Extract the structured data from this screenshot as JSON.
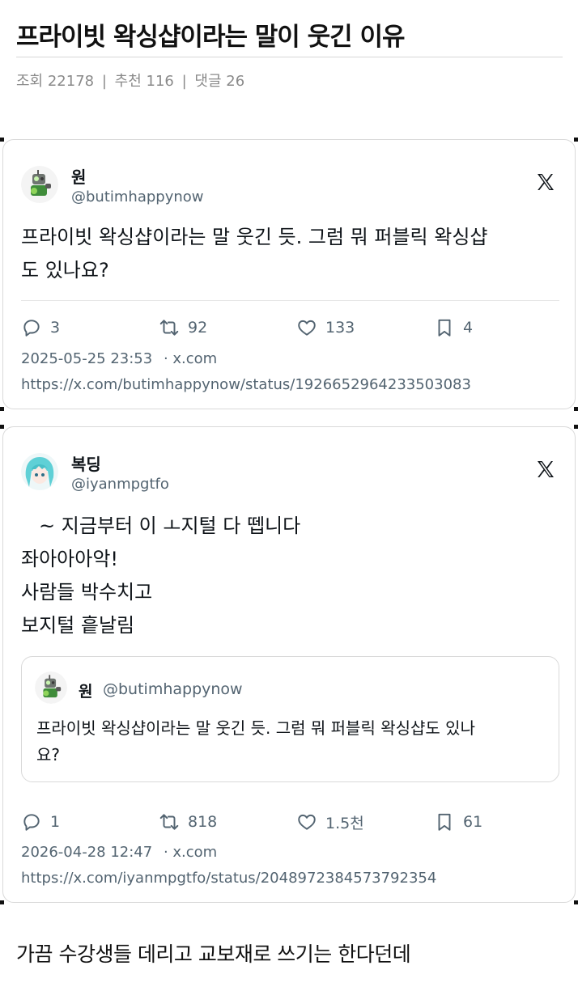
{
  "post": {
    "title": "프라이빗 왁싱샵이라는 말이 웃긴 이유",
    "views_label": "조회 22178",
    "recommend_label": "추천 116",
    "comments_label": "댓글 26",
    "separator": "|"
  },
  "tweets": [
    {
      "name": "원",
      "handle": "@butimhappynow",
      "avatar_icon": "robot-avatar",
      "text_lines": [
        "프라이빗 왁싱샵이라는 말 웃긴 듯. 그럼 뭐 퍼블릭 왁싱샵",
        "도 있나요?"
      ],
      "reply_count": "3",
      "retweet_count": "92",
      "like_count": "133",
      "bookmark_count": "4",
      "date": "2025-05-25 23:53",
      "source": "· x.com",
      "url": "https://x.com/butimhappynow/status/1926652964233503083"
    },
    {
      "name": "복딩",
      "handle": "@iyanmpgtfo",
      "avatar_icon": "anime-girl-avatar",
      "text_lines": [
        "~ 지금부터 이 ㅗ지털 다 뗍니다",
        "좌아아아악!",
        "사람들 박수치고",
        "보지털 흩날림"
      ],
      "quote": {
        "name": "원",
        "handle": "@butimhappynow",
        "text_lines": [
          "프라이빗 왁싱샵이라는 말 웃긴 듯. 그럼 뭐 퍼블릭 왁싱샵도 있나",
          "요?"
        ]
      },
      "reply_count": "1",
      "retweet_count": "818",
      "like_count": "1.5천",
      "bookmark_count": "61",
      "date": "2026-04-28 12:47",
      "source": "· x.com",
      "url": "https://x.com/iyanmpgtfo/status/2048972384573792354"
    }
  ],
  "footer_text": "가끔 수강생들 데리고 교보재로 쓰기는 한다던데",
  "colors": {
    "text_primary": "#0f1419",
    "text_secondary": "#536471",
    "meta_gray": "#8a8a8a",
    "border": "#d9d9d9"
  }
}
